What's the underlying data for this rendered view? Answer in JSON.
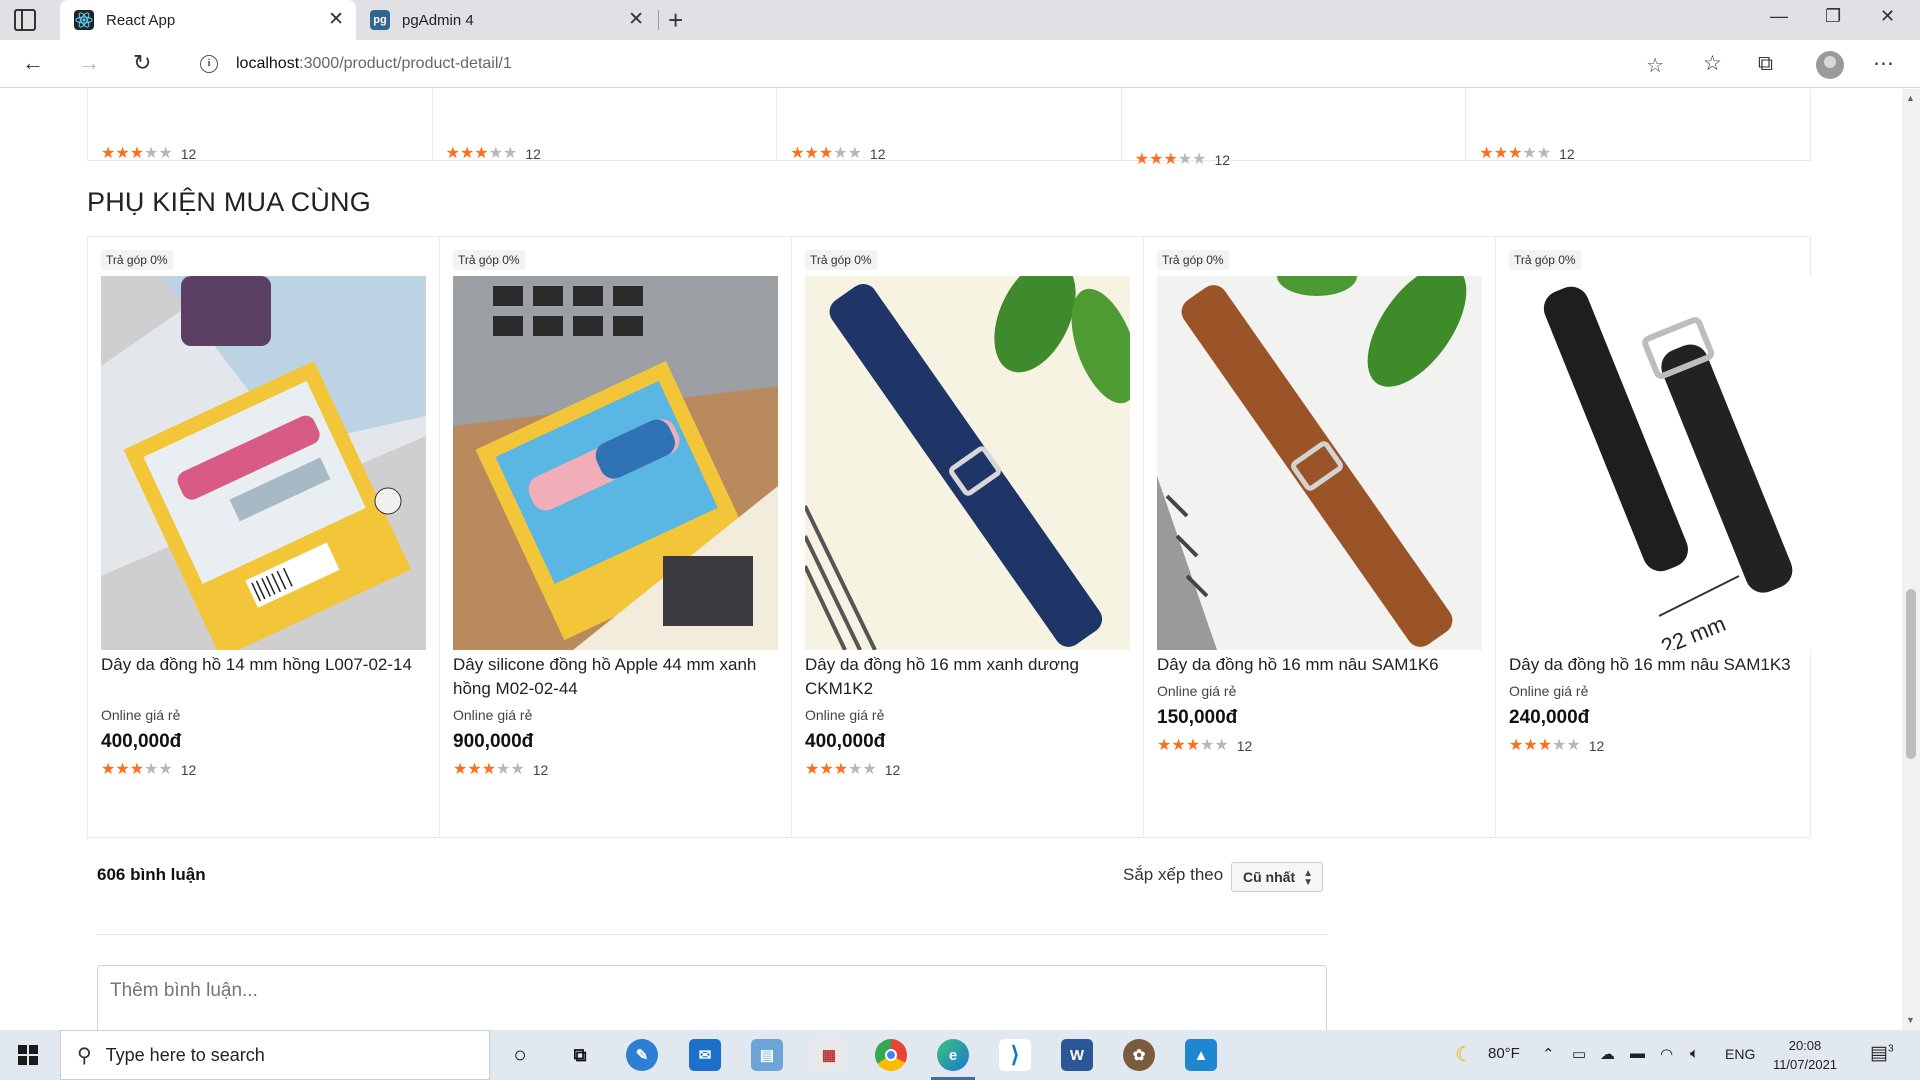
{
  "browser": {
    "tabs": [
      {
        "title": "React App",
        "icon": "react-icon"
      },
      {
        "title": "pgAdmin 4",
        "icon": "pgadmin-icon",
        "icon_text": "pg"
      }
    ],
    "url_host": "localhost",
    "url_path": ":3000/product/product-detail/1"
  },
  "top_row": {
    "ratings": [
      {
        "count": "12",
        "stars": 3
      },
      {
        "count": "12",
        "stars": 3
      },
      {
        "count": "12",
        "stars": 3
      },
      {
        "count": "12",
        "stars": 3
      },
      {
        "count": "12",
        "stars": 3
      }
    ]
  },
  "section": {
    "title": "PHỤ KIỆN MUA CÙNG"
  },
  "products": [
    {
      "badge": "Trả góp 0%",
      "name": "Dây da đồng hồ 14 mm hồng L007-02-14",
      "online": "Online giá rẻ",
      "price": "400,000đ",
      "rating_count": "12",
      "stars": 3
    },
    {
      "badge": "Trả góp 0%",
      "name": "Dây silicone đồng hồ Apple 44 mm xanh hồng M02-02-44",
      "online": "Online giá rẻ",
      "price": "900,000đ",
      "rating_count": "12",
      "stars": 3
    },
    {
      "badge": "Trả góp 0%",
      "name": "Dây da đồng hồ 16 mm xanh dương CKM1K2",
      "online": "Online giá rẻ",
      "price": "400,000đ",
      "rating_count": "12",
      "stars": 3
    },
    {
      "badge": "Trả góp 0%",
      "name": "Dây da đồng hồ 16 mm nâu SAM1K6",
      "online": "Online giá rẻ",
      "price": "150,000đ",
      "rating_count": "12",
      "stars": 3
    },
    {
      "badge": "Trả góp 0%",
      "name": "Dây da đồng hồ 16 mm nâu SAM1K3",
      "online": "Online giá rẻ",
      "price": "240,000đ",
      "rating_count": "12",
      "stars": 3,
      "image_label": "22 mm"
    }
  ],
  "comments": {
    "count_label": "606 bình luận",
    "sort_label": "Sắp xếp theo",
    "sort_value": "Cũ nhất",
    "input_placeholder": "Thêm bình luận..."
  },
  "taskbar": {
    "search_placeholder": "Type here to search",
    "weather": "80°F",
    "language": "ENG",
    "time": "20:08",
    "date": "11/07/2021",
    "notification_count": "3"
  }
}
